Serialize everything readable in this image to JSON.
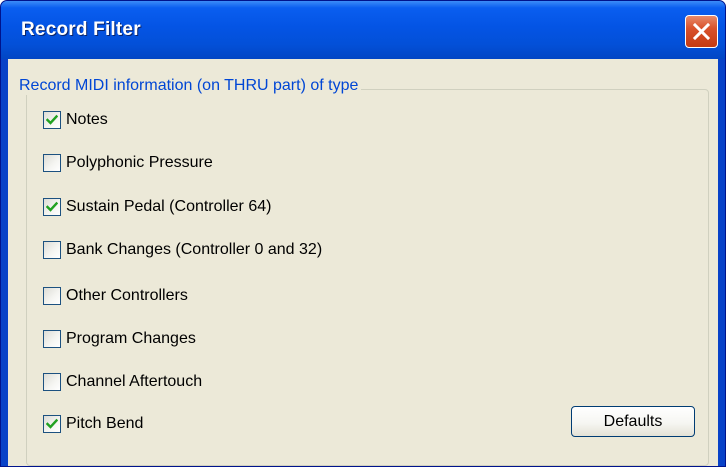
{
  "window": {
    "title": "Record Filter",
    "close_icon": "close-icon"
  },
  "group": {
    "legend": "Record MIDI information (on THRU part) of type"
  },
  "checkboxes": [
    {
      "label": "Notes",
      "checked": true
    },
    {
      "label": "Polyphonic Pressure",
      "checked": false
    },
    {
      "label": "Sustain Pedal (Controller 64)",
      "checked": true
    },
    {
      "label": "Bank Changes (Controller 0 and 32)",
      "checked": false
    },
    {
      "label": "Other Controllers",
      "checked": false
    },
    {
      "label": "Program Changes",
      "checked": false
    },
    {
      "label": "Channel Aftertouch",
      "checked": false
    },
    {
      "label": "Pitch Bend",
      "checked": true
    }
  ],
  "buttons": {
    "defaults_label": "Defaults"
  },
  "colors": {
    "titlebar": "#0454e4",
    "client_background": "#ece9d8",
    "legend_text": "#0046d5",
    "check_mark": "#21a121",
    "close_button": "#d9522c"
  }
}
